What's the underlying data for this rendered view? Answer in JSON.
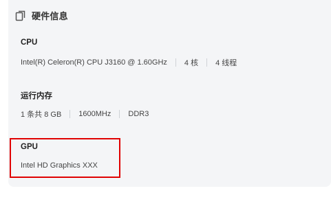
{
  "section": {
    "title": "硬件信息",
    "icon": "document-copy-icon"
  },
  "cpu": {
    "label": "CPU",
    "model": "Intel(R) Celeron(R) CPU J3160 @ 1.60GHz",
    "cores": "4 核",
    "threads": "4 线程"
  },
  "memory": {
    "label": "运行内存",
    "modules": "1 条共 8 GB",
    "speed": "1600MHz",
    "type": "DDR3"
  },
  "gpu": {
    "label": "GPU",
    "model": "Intel HD Graphics XXX"
  },
  "colors": {
    "highlight": "#e00000",
    "panel_background": "#f4f5f7"
  }
}
